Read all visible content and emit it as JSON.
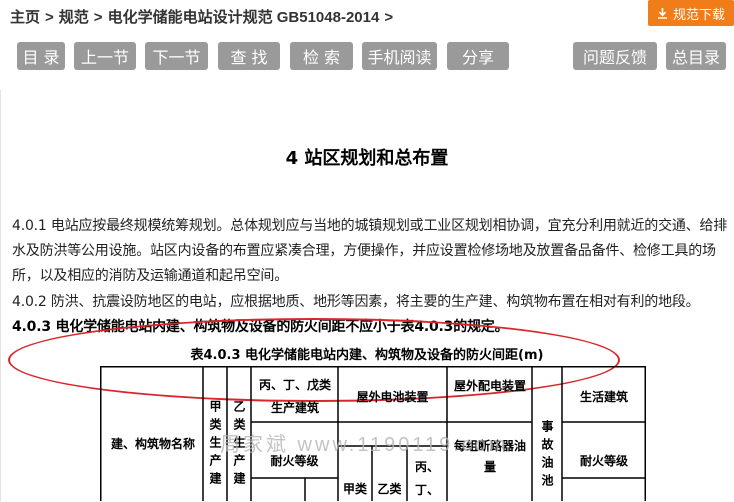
{
  "breadcrumb": [
    "主页",
    "规范",
    "电化学储能电站设计规范 GB51048-2014"
  ],
  "breadcrumb_sep": ">",
  "download_button": "规范下载",
  "toolbar": [
    "目 录",
    "上一节",
    "下一节",
    "查 找",
    "检 索",
    "手机阅读",
    "分享",
    "问题反馈",
    "总目录"
  ],
  "chapter_title": "4 站区规划和总布置",
  "paragraphs": [
    "4.0.1 电站应按最终规模统筹规划。总体规划应与当地的城镇规划或工业区规划相协调，宜充分利用就近的交通、给排水及防洪等公用设施。站区内设备的布置应紧凑合理，方便操作，并应设置检修场地及放置备品备件、检修工具的场所，以及相应的消防及运输通道和起吊空间。",
    "4.0.2 防洪、抗震设防地区的电站，应根据地质、地形等因素，将主要的生产建、构筑物布置在相对有利的地段。",
    "4.0.3 电化学储能电站内建、构筑物及设备的防火间距不应小于表4.0.3的规定。"
  ],
  "table": {
    "caption": "表4.0.3 电化学储能电站内建、构筑物及设备的防火间距(m)",
    "headers": {
      "name": "建、构筑物名称",
      "jia": "甲类生产建",
      "yi": "乙类生产建",
      "bing": "丙、丁、戊类生产建筑",
      "fire_level": "耐火等级",
      "outdoor": "屋外电池装置",
      "outdoor_jia": "甲类",
      "outdoor_yi": "乙类",
      "outdoor_bing": "丙、丁、",
      "dist": "屋外配电装置",
      "transformer": "每组断路器油量",
      "accident": "事故油池",
      "living": "生活建筑",
      "living_fire": "耐火等级"
    }
  },
  "watermark": "周家斌 www.1190119.com",
  "colors": {
    "accent": "#f07d1a",
    "button": "#9a9a9a",
    "annotation": "#d9262c"
  }
}
